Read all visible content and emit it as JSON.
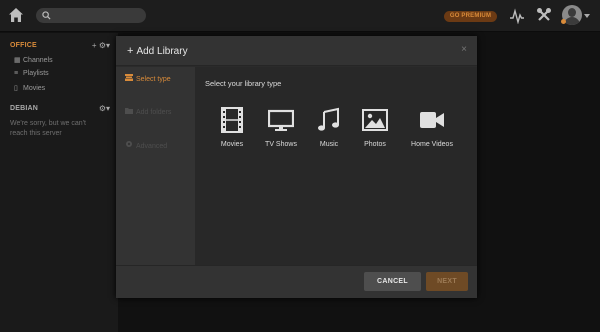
{
  "topbar": {
    "home_icon": "home-icon",
    "search_icon": "search-icon",
    "search_placeholder": "",
    "premium_label": "GO PREMIUM",
    "activity_icon": "activity-icon",
    "settings_icon": "wrench-icon",
    "avatar_icon": "avatar",
    "colors": {
      "accent": "#d98b3a",
      "bar": "#1d1d1d"
    }
  },
  "sidebar": {
    "servers": [
      {
        "name": "OFFICE",
        "actions": [
          "+",
          "⚙▾"
        ],
        "items": [
          {
            "label": "Channels",
            "icon": "grid-icon"
          },
          {
            "label": "Playlists",
            "icon": "list-icon"
          },
          {
            "label": "Movies",
            "icon": "film-icon"
          }
        ]
      },
      {
        "name": "DEBIAN",
        "actions": [
          "⚙▾"
        ],
        "message": "We're sorry, but we can't reach this server"
      }
    ]
  },
  "modal": {
    "title": "Add Library",
    "title_icon": "plus-icon",
    "close_label": "×",
    "steps": [
      {
        "label": "Select type",
        "icon": "library-icon",
        "state": "active"
      },
      {
        "label": "Add folders",
        "icon": "folder-icon",
        "state": "disabled"
      },
      {
        "label": "Advanced",
        "icon": "gear-icon",
        "state": "disabled"
      }
    ],
    "prompt": "Select your library type",
    "types": [
      {
        "label": "Movies",
        "icon": "film-icon"
      },
      {
        "label": "TV Shows",
        "icon": "tv-icon"
      },
      {
        "label": "Music",
        "icon": "music-icon"
      },
      {
        "label": "Photos",
        "icon": "photo-icon"
      },
      {
        "label": "Home Videos",
        "icon": "video-camera-icon"
      }
    ],
    "cancel_label": "CANCEL",
    "next_label": "NEXT"
  }
}
